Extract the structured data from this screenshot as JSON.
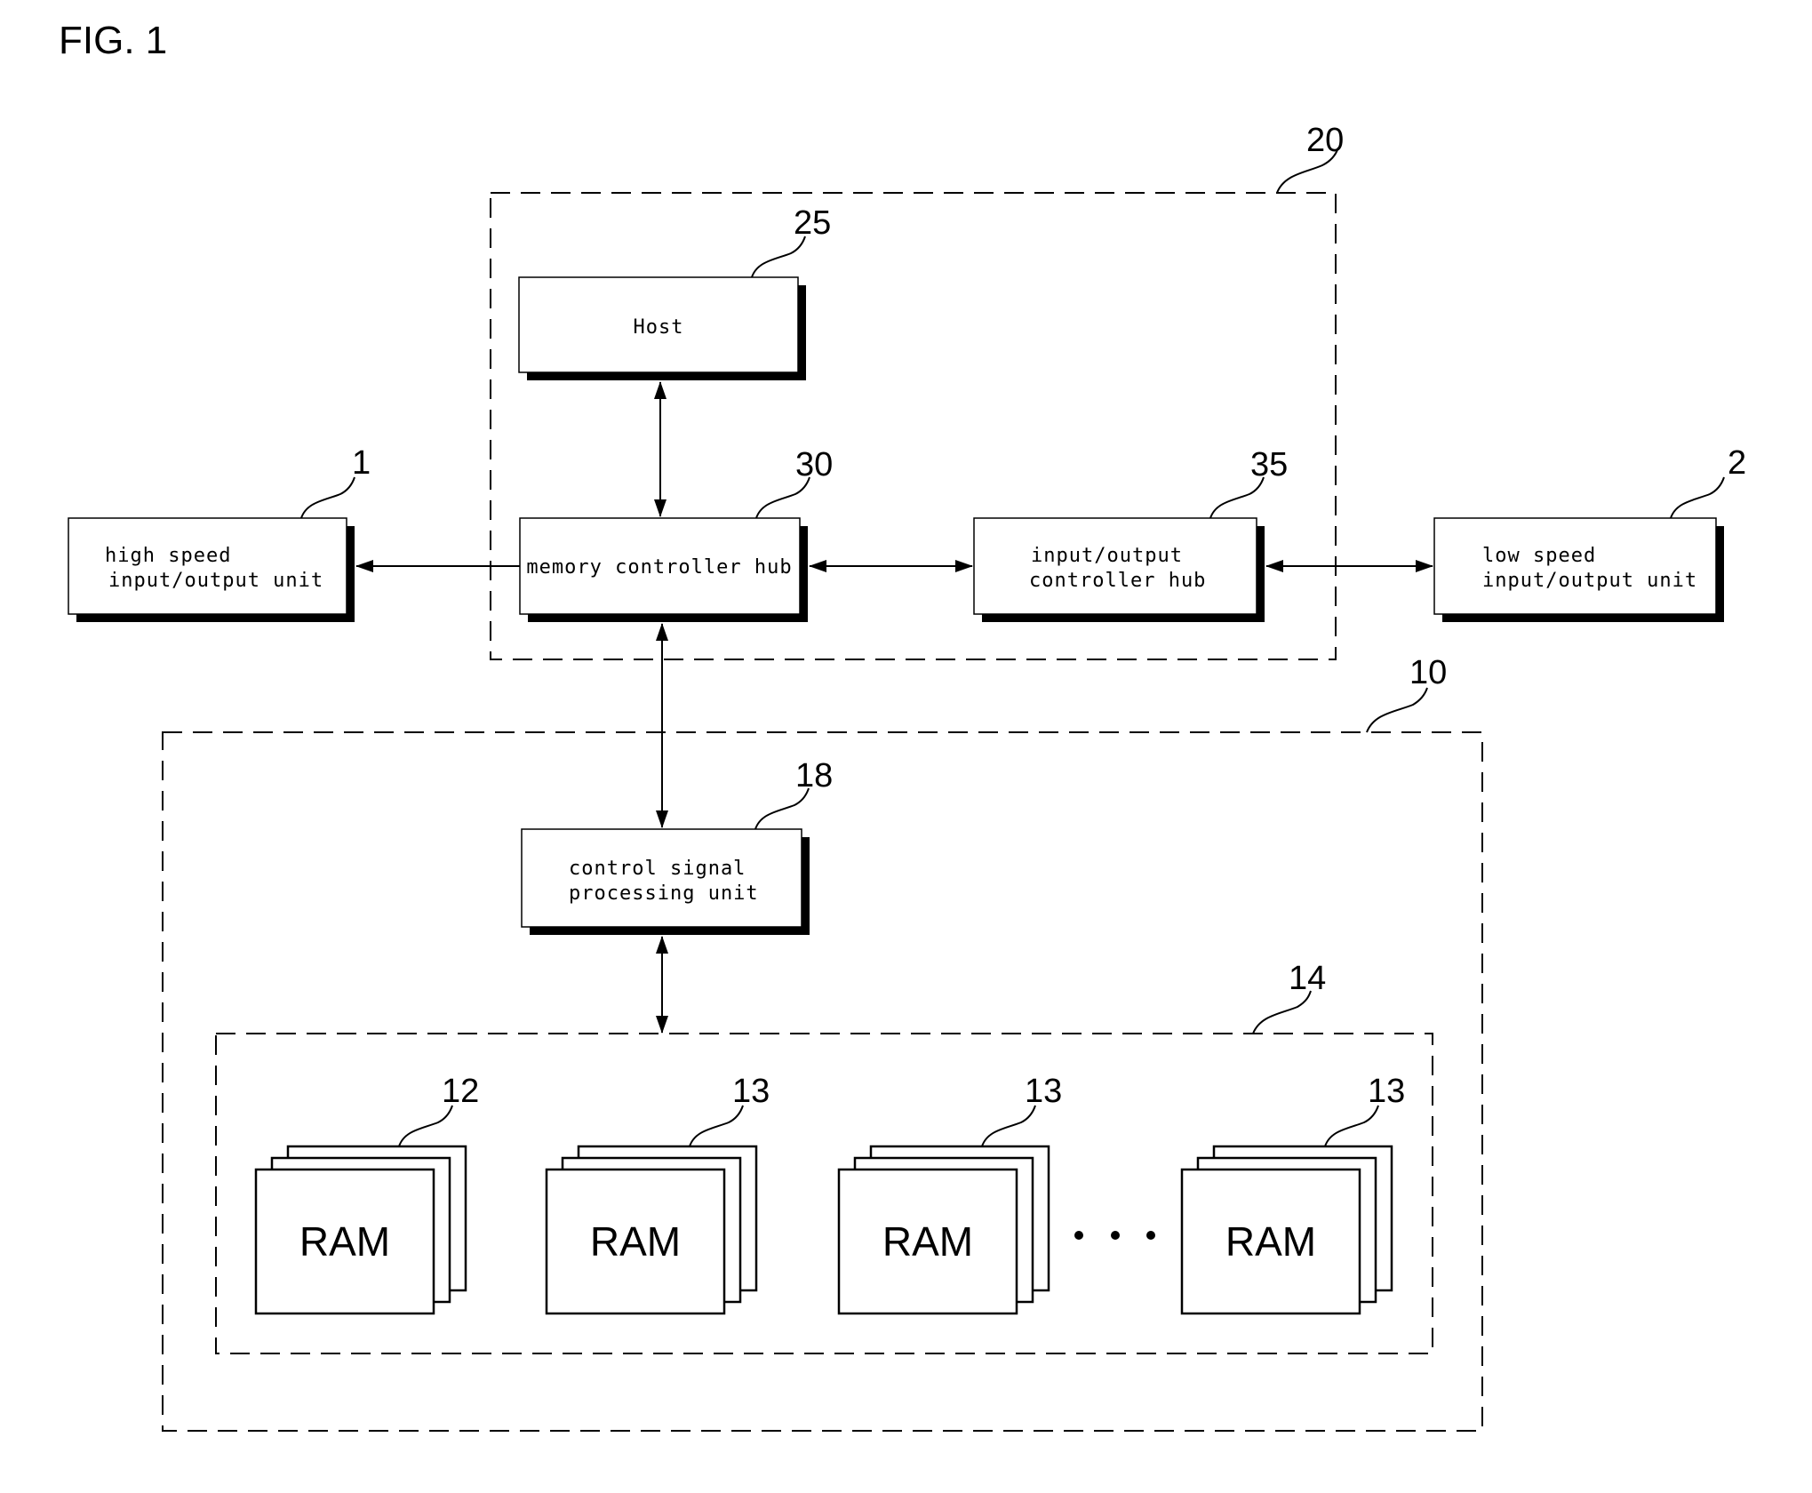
{
  "figure": {
    "title": "FIG. 1"
  },
  "groups": {
    "system": {
      "ref": "20"
    },
    "memory_module": {
      "ref": "10"
    },
    "ram_array": {
      "ref": "14"
    }
  },
  "blocks": {
    "host": {
      "ref": "25",
      "lines": [
        "Host"
      ]
    },
    "mch": {
      "ref": "30",
      "lines": [
        "memory controller hub"
      ]
    },
    "ioch": {
      "ref": "35",
      "lines": [
        "input/output",
        "controller hub"
      ]
    },
    "high_io": {
      "ref": "1",
      "lines": [
        "high speed",
        "input/output unit"
      ]
    },
    "low_io": {
      "ref": "2",
      "lines": [
        "low speed",
        "input/output unit"
      ]
    },
    "cspu": {
      "ref": "18",
      "lines": [
        "control signal",
        "processing unit"
      ]
    }
  },
  "rams": [
    {
      "ref": "12",
      "label": "RAM"
    },
    {
      "ref": "13",
      "label": "RAM"
    },
    {
      "ref": "13",
      "label": "RAM"
    },
    {
      "ref": "13",
      "label": "RAM"
    }
  ],
  "ellipsis": "· · ·",
  "connections": [
    {
      "from": "host",
      "to": "mch",
      "direction": "bidirectional"
    },
    {
      "from": "mch",
      "to": "high_io",
      "direction": "one-way"
    },
    {
      "from": "mch",
      "to": "ioch",
      "direction": "bidirectional"
    },
    {
      "from": "ioch",
      "to": "low_io",
      "direction": "bidirectional"
    },
    {
      "from": "mch",
      "to": "cspu",
      "direction": "bidirectional"
    },
    {
      "from": "cspu",
      "to": "ram_array",
      "direction": "bidirectional"
    }
  ]
}
